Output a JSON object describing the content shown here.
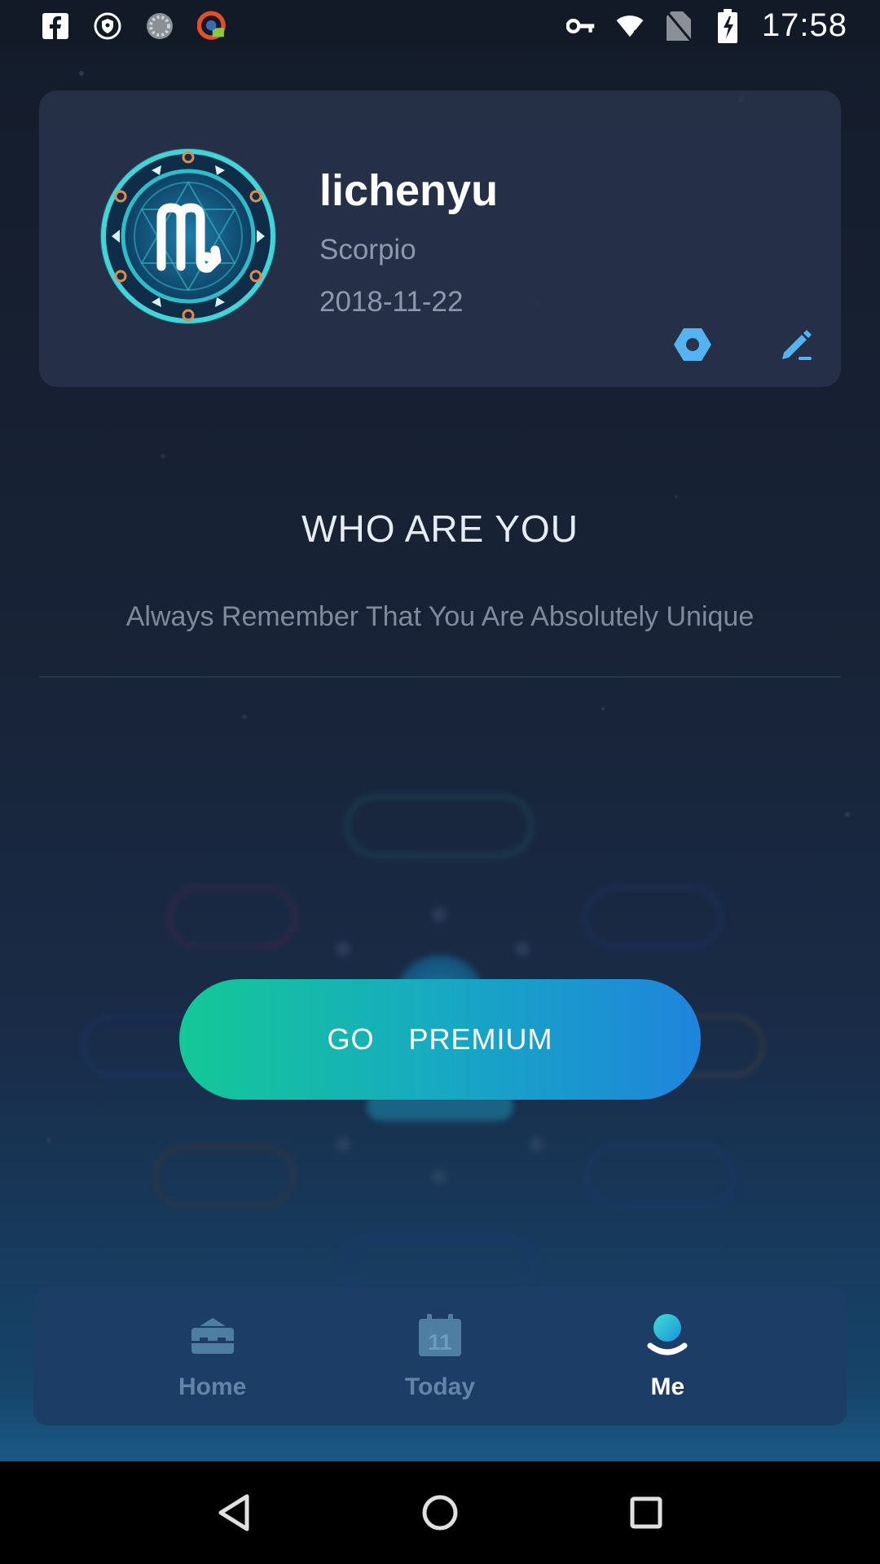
{
  "status_bar": {
    "time": "17:58",
    "left_icons": [
      "facebook-icon",
      "vpn-shield-icon",
      "loading-circle-icon",
      "app-notification-icon"
    ],
    "right_icons": [
      "key-icon",
      "wifi-icon",
      "no-sim-icon",
      "battery-charging-icon"
    ]
  },
  "profile": {
    "name": "lichenyu",
    "sign": "Scorpio",
    "birth_date": "2018-11-22",
    "avatar_icon": "scorpio-zodiac-icon",
    "actions": [
      "settings-icon",
      "edit-icon"
    ]
  },
  "section": {
    "title": "WHO ARE YOU",
    "subtitle": "Always Remember That You Are Absolutely Unique"
  },
  "premium_button": {
    "label": "GO  PREMIUM"
  },
  "bottom_nav": {
    "items": [
      {
        "label": "Home",
        "icon": "home-icon",
        "active": false
      },
      {
        "label": "Today",
        "icon": "calendar-icon",
        "badge": "11",
        "active": false
      },
      {
        "label": "Me",
        "icon": "user-icon",
        "active": true
      }
    ]
  },
  "system_nav": [
    "back-icon",
    "home-circle-icon",
    "recents-icon"
  ],
  "colors": {
    "accent_green": "#14c896",
    "accent_blue": "#1f84dc",
    "nav_inactive": "#6583a6",
    "nav_bg": "#1c3d66",
    "card_bg": "#28344c"
  }
}
